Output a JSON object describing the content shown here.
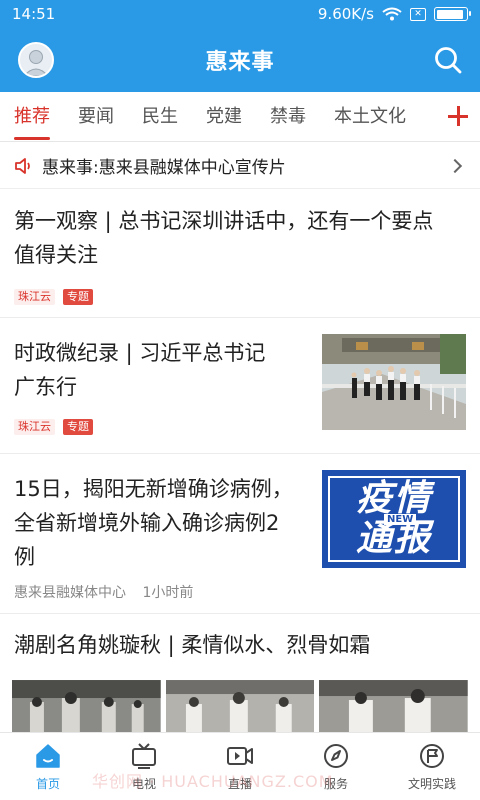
{
  "status_bar": {
    "time": "14:51",
    "speed": "9.60K/s",
    "sim_label": "✕"
  },
  "header": {
    "title": "惠来事",
    "avatar_icon": "user-avatar",
    "search_icon": "search-icon"
  },
  "tabs": [
    {
      "label": "推荐",
      "active": true
    },
    {
      "label": "要闻"
    },
    {
      "label": "民生"
    },
    {
      "label": "党建"
    },
    {
      "label": "禁毒"
    },
    {
      "label": "本土文化"
    }
  ],
  "notice": {
    "text": "惠来事:惠来县融媒体中心宣传片",
    "icon": "speaker-icon"
  },
  "articles": [
    {
      "title_lines": [
        "第一观察 | 总书记深圳讲话中，还有一个要点",
        "值得关注"
      ],
      "tags": [
        "珠江云",
        "专题"
      ]
    },
    {
      "title_lines": [
        "时政微纪录 | 习近平总书记",
        "广东行"
      ],
      "tags": [
        "珠江云",
        "专题"
      ]
    },
    {
      "title_lines": [
        "15日，揭阳无新增确诊病例，",
        "全省新增境外输入确诊病例2",
        "例"
      ],
      "source": "惠来县融媒体中心",
      "time": "1小时前",
      "thumb_text": [
        "疫情",
        "通报"
      ],
      "thumb_badge": "NEW"
    },
    {
      "title_lines": [
        "潮剧名角姚璇秋 | 柔情似水、烈骨如霜"
      ]
    }
  ],
  "bottom_nav": [
    {
      "label": "首页",
      "icon": "home-icon",
      "active": true
    },
    {
      "label": "电视",
      "icon": "tv-icon"
    },
    {
      "label": "直播",
      "icon": "live-camera-icon"
    },
    {
      "label": "服务",
      "icon": "compass-icon"
    },
    {
      "label": "文明实践",
      "icon": "flag-icon"
    }
  ],
  "watermark": "华创网 · HUACHUANGZ.COM",
  "colors": {
    "brand_blue": "#2b9ae6",
    "accent_red": "#d9342b"
  }
}
